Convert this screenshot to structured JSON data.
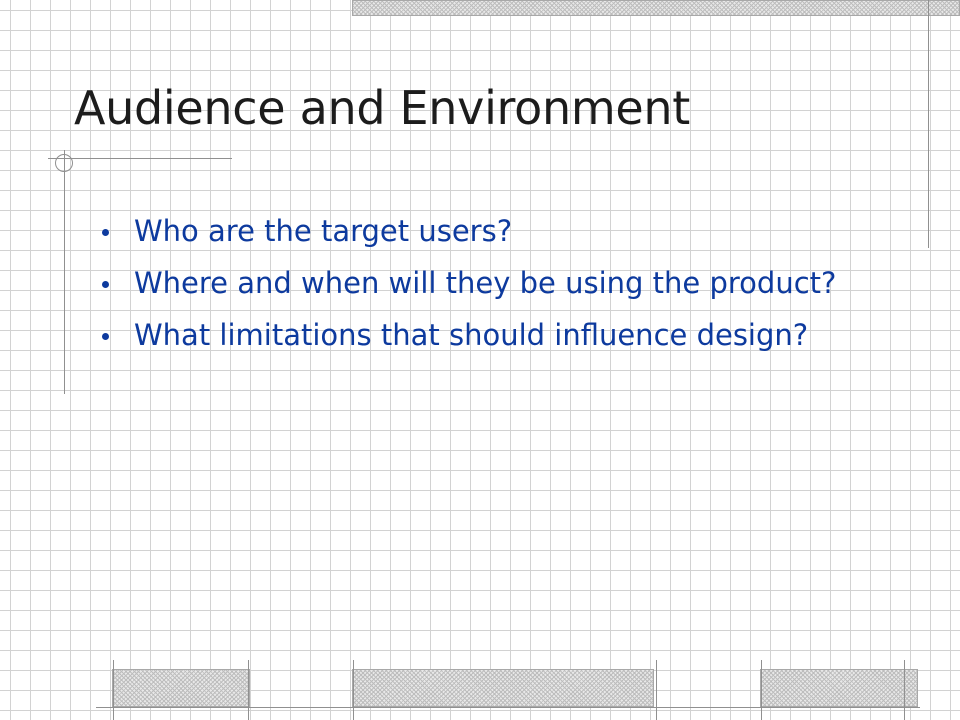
{
  "slide": {
    "title": "Audience and Environment",
    "bullets": [
      "Who are the target users?",
      "Where and when will they be using the product?",
      "What limitations that should influence design?"
    ]
  },
  "colors": {
    "title": "#1c1c1c",
    "bullet_text": "#0d3a9e",
    "grid_line": "#d2d2d2",
    "background": "#ffffff"
  }
}
